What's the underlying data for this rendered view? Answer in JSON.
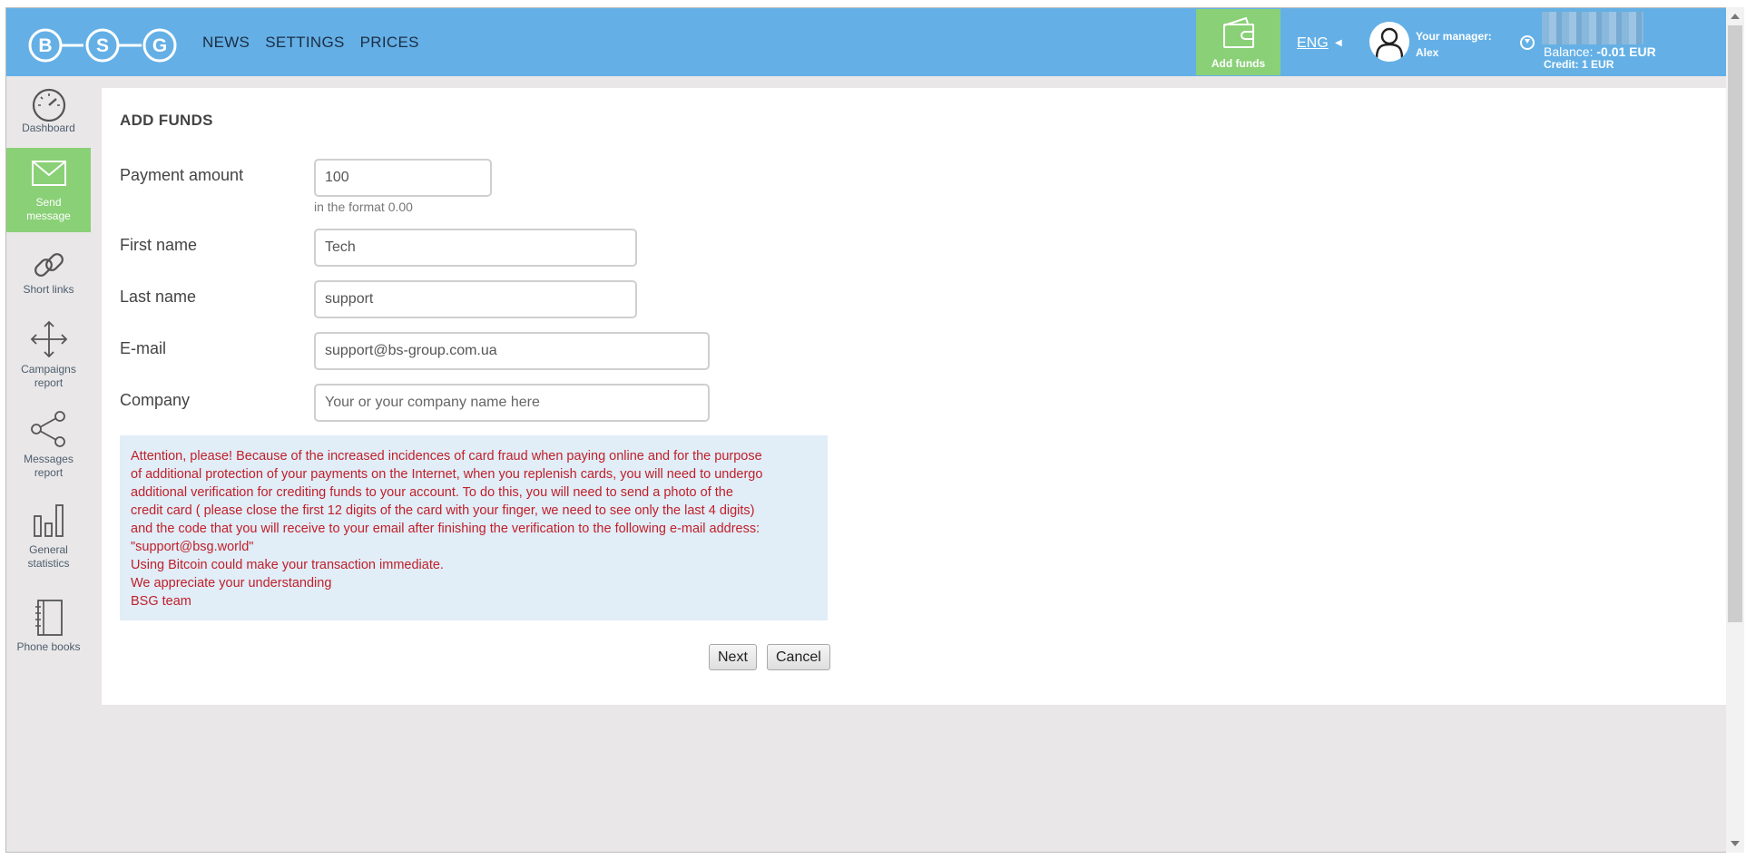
{
  "brand": {
    "logo_letters": [
      "B",
      "S",
      "G"
    ]
  },
  "header": {
    "nav": [
      "NEWS",
      "SETTINGS",
      "PRICES"
    ],
    "add_funds_label": "Add funds",
    "language": "ENG",
    "manager_label": "Your manager:",
    "manager_name": "Alex",
    "balance_label": "Balance:",
    "balance_value": "-0.01 EUR",
    "credit_label": "Credit:",
    "credit_value": "1 EUR"
  },
  "sidebar": {
    "items": [
      {
        "label_lines": [
          "Dashboard"
        ],
        "icon": "speedometer-icon",
        "active": false
      },
      {
        "label_lines": [
          "Send",
          "message"
        ],
        "icon": "envelope-icon",
        "active": true
      },
      {
        "label_lines": [
          "Short links"
        ],
        "icon": "link-icon",
        "active": false
      },
      {
        "label_lines": [
          "Campaigns",
          "report"
        ],
        "icon": "move-arrows-icon",
        "active": false
      },
      {
        "label_lines": [
          "Messages",
          "report"
        ],
        "icon": "share-icon",
        "active": false
      },
      {
        "label_lines": [
          "General",
          "statistics"
        ],
        "icon": "bar-chart-icon",
        "active": false
      },
      {
        "label_lines": [
          "Phone books"
        ],
        "icon": "notebook-icon",
        "active": false
      }
    ]
  },
  "form": {
    "title": "ADD FUNDS",
    "payment_amount": {
      "label": "Payment amount",
      "value": "100",
      "hint": "in the format 0.00"
    },
    "first_name": {
      "label": "First name",
      "value": "Tech"
    },
    "last_name": {
      "label": "Last name",
      "value": "support"
    },
    "email": {
      "label": "E-mail",
      "value": "support@bs-group.com.ua"
    },
    "company": {
      "label": "Company",
      "value": "",
      "placeholder": "Your or your company name here"
    },
    "notice_lines": [
      "Attention, please! Because of the increased incidences of card fraud when paying online and for the purpose",
      "of additional protection of your payments on the Internet, when you replenish cards, you will need to undergo",
      "additional verification for crediting funds to your account. To do this, you will need to send a photo of the",
      "credit card ( please close the first 12 digits of the card with your finger, we need to see only the last 4 digits)",
      "and the code that you will receive to your email after finishing the verification to the following e-mail address:",
      "\"support@bsg.world\"",
      "Using Bitcoin could make your transaction immediate.",
      "We appreciate your understanding",
      "BSG team"
    ],
    "next_label": "Next",
    "cancel_label": "Cancel"
  },
  "colors": {
    "header_blue": "#64b0e6",
    "accent_green": "#8ad077",
    "notice_bg": "#e1edf7",
    "notice_text": "#c0202a"
  }
}
